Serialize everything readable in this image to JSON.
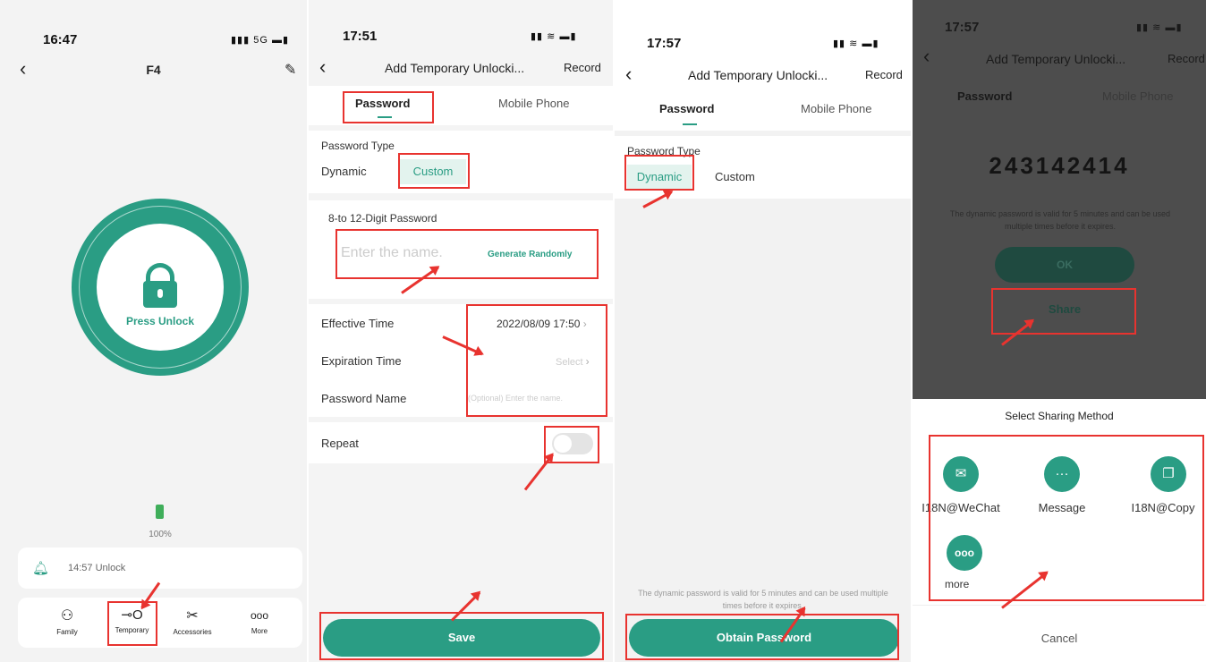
{
  "colors": {
    "accent": "#2a9d84",
    "highlight": "#e8332f"
  },
  "screen1": {
    "time": "16:47",
    "signal": "5G",
    "title": "F4",
    "press_unlock": "Press Unlock",
    "battery": "100%",
    "log_time": "14:57",
    "log_text": "Unlock",
    "tabs": [
      {
        "label": "Family",
        "icon": "family-icon"
      },
      {
        "label": "Temporary",
        "icon": "key-icon"
      },
      {
        "label": "Accessories",
        "icon": "tools-icon"
      },
      {
        "label": "More",
        "icon": "more-icon"
      }
    ]
  },
  "screen2": {
    "time": "17:51",
    "title": "Add Temporary Unlocki...",
    "record": "Record",
    "tab_password": "Password",
    "tab_mobile": "Mobile Phone",
    "password_type": "Password Type",
    "dynamic": "Dynamic",
    "custom": "Custom",
    "digit_label": "8-to 12-Digit Password",
    "placeholder": "Enter the name.",
    "generate": "Generate Randomly",
    "effective": "Effective Time",
    "effective_value": "2022/08/09 17:50",
    "expiration": "Expiration Time",
    "expiration_value": "Select",
    "pw_name": "Password Name",
    "pw_name_placeholder": "(Optional) Enter the name.",
    "repeat": "Repeat",
    "save": "Save"
  },
  "screen3": {
    "time": "17:57",
    "title": "Add Temporary Unlocki...",
    "record": "Record",
    "tab_password": "Password",
    "tab_mobile": "Mobile Phone",
    "password_type": "Password Type",
    "dynamic": "Dynamic",
    "custom": "Custom",
    "note": "The dynamic password is valid for 5 minutes and can be used multiple times before it expires.",
    "obtain": "Obtain Password"
  },
  "screen4": {
    "time": "17:57",
    "title": "Add Temporary Unlocki...",
    "record": "Record",
    "tab_password": "Password",
    "tab_mobile": "Mobile Phone",
    "code": "243142414",
    "note": "The dynamic password is valid for 5 minutes and can be used multiple times before it expires.",
    "ok": "OK",
    "share": "Share",
    "sheet_title": "Select Sharing Method",
    "methods": [
      {
        "label": "I18N@WeChat",
        "icon": "wechat-icon"
      },
      {
        "label": "Message",
        "icon": "message-icon"
      },
      {
        "label": "I18N@Copy",
        "icon": "copy-icon"
      },
      {
        "label": "more",
        "icon": "more-icon"
      }
    ],
    "cancel": "Cancel"
  }
}
